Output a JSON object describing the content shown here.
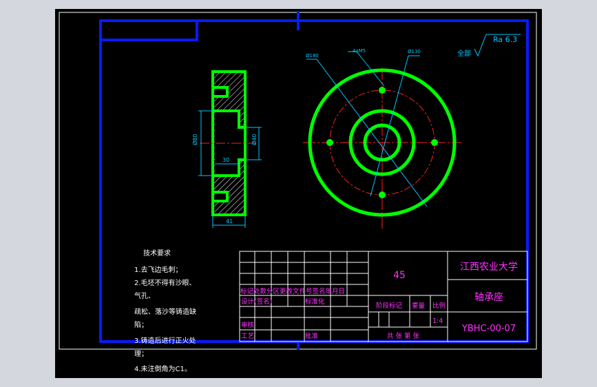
{
  "colors": {
    "background": "#000000",
    "chrome": "#d4d8de",
    "frame_blue": "#0a1aff",
    "part_green": "#00ff00",
    "center_red": "#ff2020",
    "dim_cyan": "#00c8ff",
    "text_magenta": "#ff33ff",
    "table_white": "#ffffff"
  },
  "section_view": {
    "dim_width": "41",
    "dim_bore_depth": "30",
    "dim_outer": "Ø80",
    "dim_inner": "Ø40"
  },
  "front_view": {
    "dim_outer": "Ø180",
    "dim_holes": "4xM5",
    "dim_pcd": "Ø130"
  },
  "surface_finish": {
    "prefix": "全部",
    "value": "Ra 6.3"
  },
  "tech_requirements": {
    "title": "技术要求",
    "lines": [
      "1.去飞边毛刺；",
      "2.毛坯不得有沙眼、",
      "气孔、",
      "疏松、落沙等铸造缺",
      "陷；",
      "3.铸造后进行正火处",
      "理；",
      "4.未注倒角为C1。"
    ]
  },
  "title_block": {
    "material": "45",
    "school": "江西农业大学",
    "part_name": "轴承座",
    "drawing_no": "YBHC-00-07",
    "scale": "1:4",
    "row_headers": "标记处数分区更改文件号签名年月日",
    "designer_row": "设计(签名)",
    "standardize": "标准化",
    "stage_headers": [
      "阶段标记",
      "重量",
      "比例"
    ],
    "review": "审核",
    "craft": "工艺",
    "approve": "批准",
    "sheets": "共  张  第  张"
  }
}
